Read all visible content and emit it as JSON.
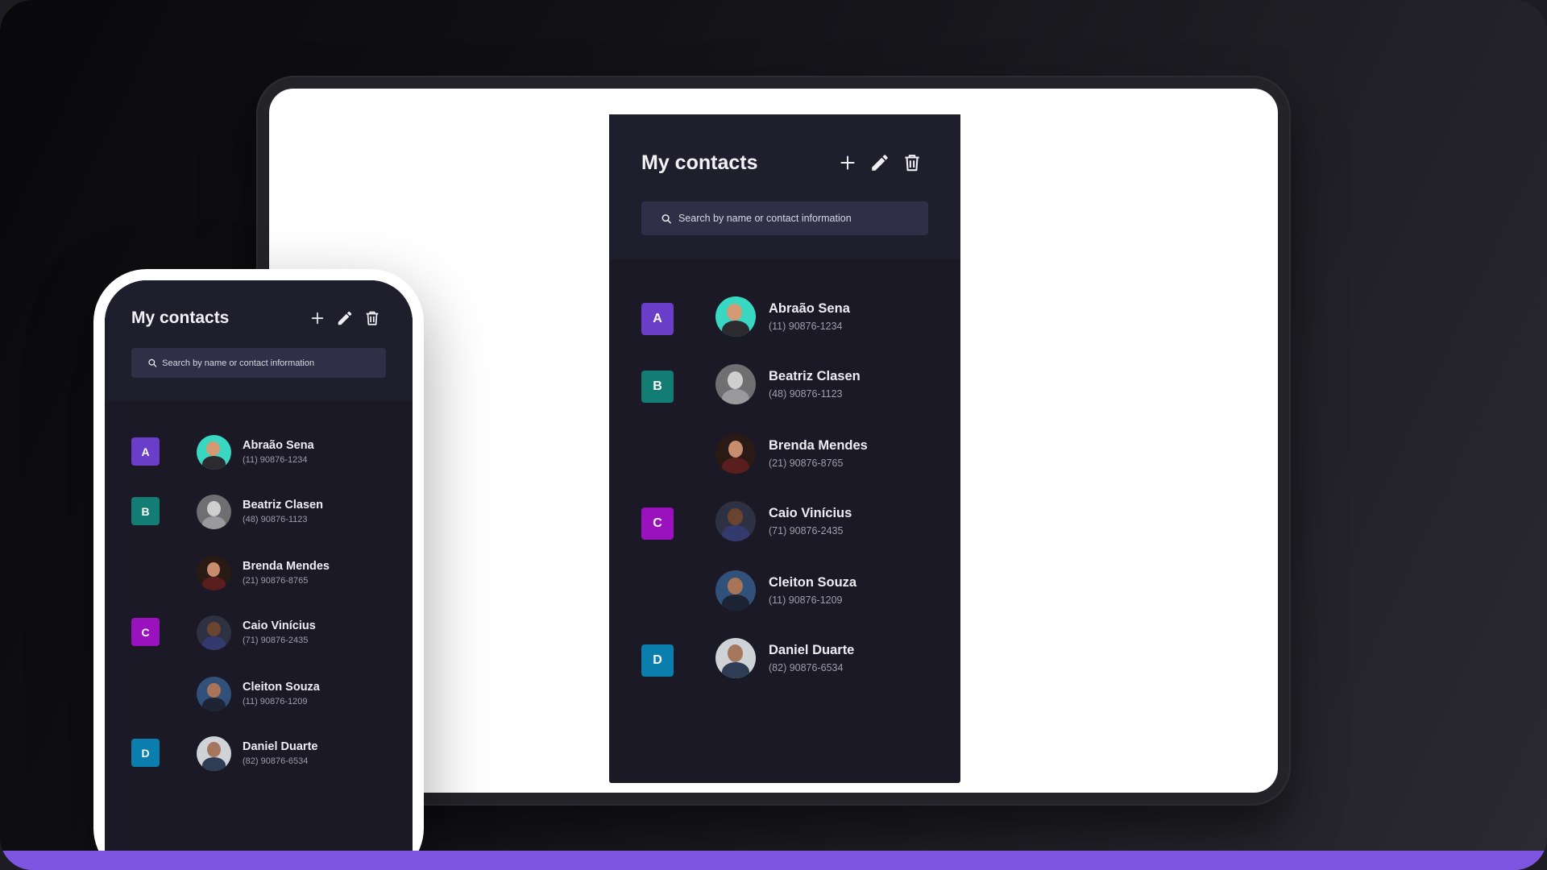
{
  "title": "My contacts",
  "search": {
    "placeholder": "Search by name or contact information"
  },
  "colors": {
    "accent": "#7d55e0",
    "letter_a": "#6a3ec8",
    "letter_b": "#137c73",
    "letter_c": "#9a12bd",
    "letter_d": "#0a7fae"
  },
  "toolbar": {
    "add": "plus-icon",
    "edit": "pencil-icon",
    "delete": "trash-icon"
  },
  "groups": [
    {
      "letter": "A",
      "contacts": [
        {
          "name": "Abraão Sena",
          "phone": "(11) 90876-1234"
        }
      ]
    },
    {
      "letter": "B",
      "contacts": [
        {
          "name": "Beatriz Clasen",
          "phone": "(48) 90876-1123"
        },
        {
          "name": "Brenda Mendes",
          "phone": "(21) 90876-8765"
        }
      ]
    },
    {
      "letter": "C",
      "contacts": [
        {
          "name": "Caio Vinícius",
          "phone": "(71) 90876-2435"
        },
        {
          "name": "Cleiton Souza",
          "phone": "(11) 90876-1209"
        }
      ]
    },
    {
      "letter": "D",
      "contacts": [
        {
          "name": "Daniel Duarte",
          "phone": "(82) 90876-6534"
        }
      ]
    }
  ]
}
